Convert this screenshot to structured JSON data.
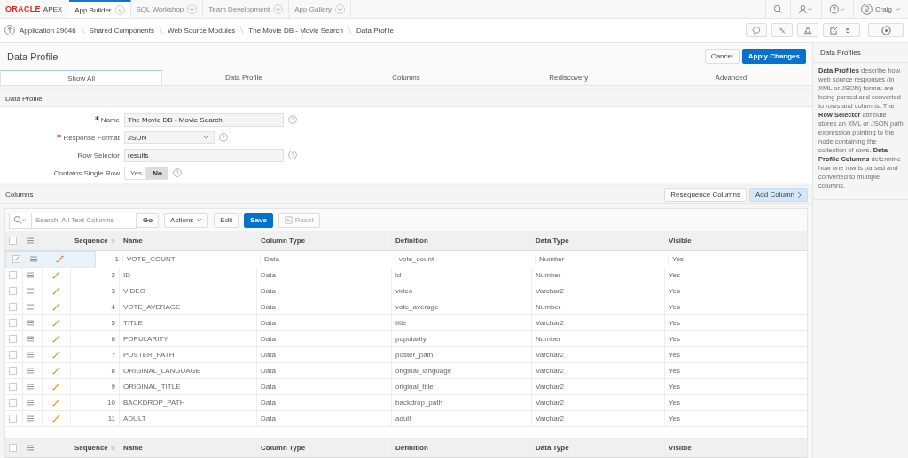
{
  "nav": {
    "logo": "ORACLE",
    "product": "APEX",
    "user": "Craig",
    "tabs": [
      {
        "label": "App Builder",
        "selected": true
      },
      {
        "label": "SQL Workshop",
        "selected": false
      },
      {
        "label": "Team Development",
        "selected": false
      },
      {
        "label": "App Gallery",
        "selected": false
      }
    ]
  },
  "breadcrumbs": [
    "Application 29046",
    "Shared Components",
    "Web Source Modules",
    "The Movie DB - Movie Search",
    "Data Profile"
  ],
  "toolbar": {
    "edit_count": "5"
  },
  "page": {
    "title": "Data Profile",
    "cancel": "Cancel",
    "apply": "Apply Changes"
  },
  "tabs": [
    {
      "label": "Show All",
      "selected": true
    },
    {
      "label": "Data Profile",
      "selected": false
    },
    {
      "label": "Columns",
      "selected": false
    },
    {
      "label": "Rediscovery",
      "selected": false
    },
    {
      "label": "Advanced",
      "selected": false
    }
  ],
  "region": {
    "title": "Data Profile",
    "fields": [
      {
        "kind": "text",
        "label": "Name",
        "required": true,
        "value": "The Movie DB - Movie Search"
      },
      {
        "kind": "select",
        "label": "Response Format",
        "required": true,
        "value": "JSON"
      },
      {
        "kind": "text",
        "label": "Row Selector",
        "required": false,
        "value": "results"
      },
      {
        "kind": "toggle",
        "label": "Contains Single Row",
        "required": false,
        "options": [
          {
            "label": "Yes",
            "selected": false
          },
          {
            "label": "No",
            "selected": true
          }
        ]
      }
    ]
  },
  "columns_region": {
    "title": "Columns",
    "resequence": "Resequence Columns",
    "add": "Add Column"
  },
  "grid": {
    "search_placeholder": "Search: All Text Columns",
    "go": "Go",
    "actions": "Actions",
    "edit": "Edit",
    "save": "Save",
    "reset": "Reset",
    "header_checked": false,
    "footer_checked": false,
    "columns": [
      "Sequence",
      "Name",
      "Column Type",
      "Definition",
      "Data Type",
      "Visible"
    ],
    "rows": [
      {
        "selected": true,
        "cells": [
          "1",
          "VOTE_COUNT",
          "Data",
          "vote_count",
          "Number",
          "Yes"
        ]
      },
      {
        "selected": false,
        "cells": [
          "2",
          "ID",
          "Data",
          "id",
          "Number",
          "Yes"
        ]
      },
      {
        "selected": false,
        "cells": [
          "3",
          "VIDEO",
          "Data",
          "video",
          "Varchar2",
          "Yes"
        ]
      },
      {
        "selected": false,
        "cells": [
          "4",
          "VOTE_AVERAGE",
          "Data",
          "vote_average",
          "Number",
          "Yes"
        ]
      },
      {
        "selected": false,
        "cells": [
          "5",
          "TITLE",
          "Data",
          "title",
          "Varchar2",
          "Yes"
        ]
      },
      {
        "selected": false,
        "cells": [
          "6",
          "POPULARITY",
          "Data",
          "popularity",
          "Number",
          "Yes"
        ]
      },
      {
        "selected": false,
        "cells": [
          "7",
          "POSTER_PATH",
          "Data",
          "poster_path",
          "Varchar2",
          "Yes"
        ]
      },
      {
        "selected": false,
        "cells": [
          "8",
          "ORIGINAL_LANGUAGE",
          "Data",
          "original_language",
          "Varchar2",
          "Yes"
        ]
      },
      {
        "selected": false,
        "cells": [
          "9",
          "ORIGINAL_TITLE",
          "Data",
          "original_title",
          "Varchar2",
          "Yes"
        ]
      },
      {
        "selected": false,
        "cells": [
          "10",
          "BACKDROP_PATH",
          "Data",
          "backdrop_path",
          "Varchar2",
          "Yes"
        ]
      },
      {
        "selected": false,
        "cells": [
          "11",
          "ADULT",
          "Data",
          "adult",
          "Varchar2",
          "Yes"
        ]
      }
    ],
    "footer_columns": [
      "Sequence",
      "Name",
      "Column Type",
      "Definition",
      "Data Type",
      "Visible"
    ]
  },
  "help": {
    "title": "Data Profiles",
    "text": "**Data Profiles** describe how web source responses (in XML or JSON) format are being parsed and converted to rows and columns. The **Row Selector** attribute stores an XML or JSON path expression pointing to the node containing the collection of rows. **Data Profile Columns** determine how one row is parsed and converted to multiple columns."
  }
}
